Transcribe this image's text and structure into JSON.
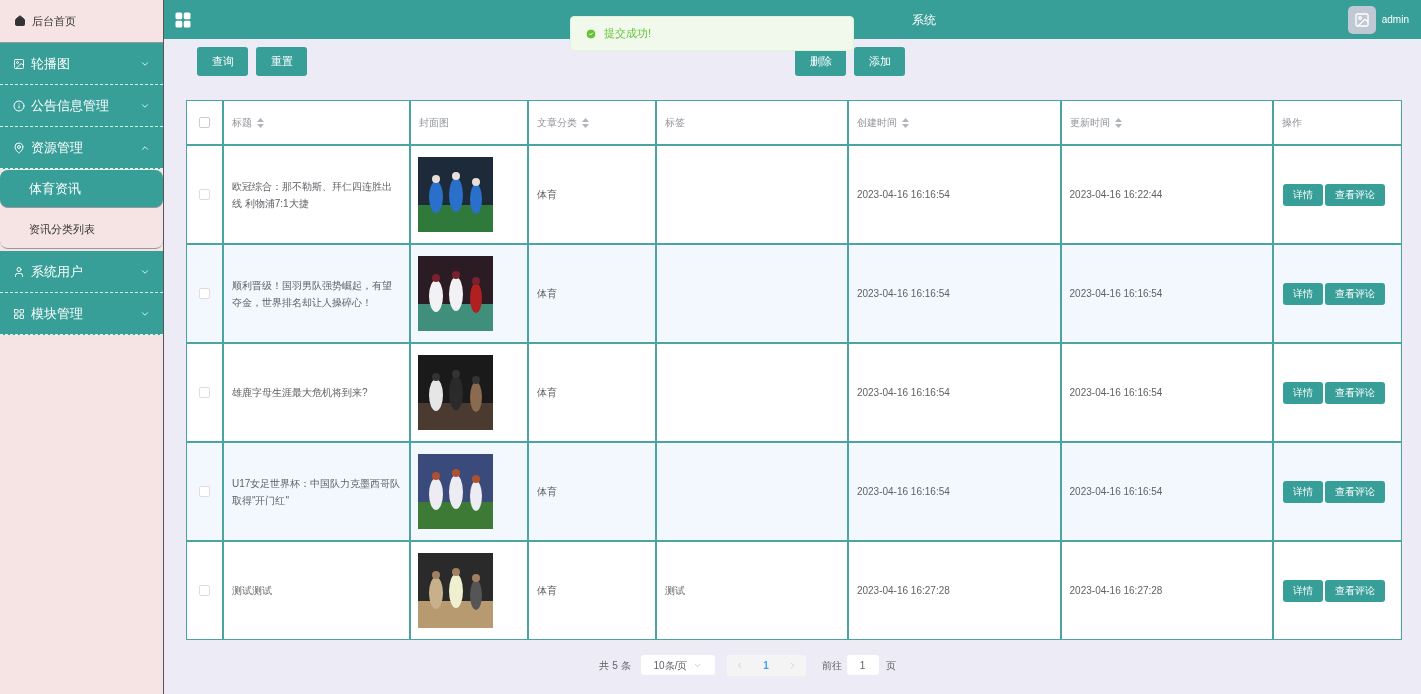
{
  "sidebar": {
    "items": [
      {
        "kind": "link",
        "label": "后台首页",
        "selected": false
      },
      {
        "kind": "menu",
        "label": "轮播图",
        "expanded": false
      },
      {
        "kind": "menu",
        "label": "公告信息管理",
        "expanded": false
      },
      {
        "kind": "menu",
        "label": "资源管理",
        "expanded": true,
        "children": [
          {
            "label": "体育资讯",
            "selected": true
          },
          {
            "label": "资讯分类列表",
            "selected": false
          }
        ]
      },
      {
        "kind": "menu",
        "label": "系统用户",
        "expanded": false
      },
      {
        "kind": "menu",
        "label": "模块管理",
        "expanded": false
      }
    ]
  },
  "header": {
    "title_visible": "系统",
    "user": "admin"
  },
  "toast": {
    "message": "提交成功!"
  },
  "toolbar": {
    "left_buttons": [
      "查询",
      "重置"
    ],
    "right_buttons": [
      "删除",
      "添加"
    ]
  },
  "table": {
    "columns": [
      {
        "label": "标题",
        "sortable": true
      },
      {
        "label": "封面图",
        "sortable": false
      },
      {
        "label": "文章分类",
        "sortable": true
      },
      {
        "label": "标签",
        "sortable": false
      },
      {
        "label": "创建时间",
        "sortable": true
      },
      {
        "label": "更新时间",
        "sortable": true
      },
      {
        "label": "操作",
        "sortable": false
      }
    ],
    "rows": [
      {
        "checked": false,
        "title": "欧冠综合：那不勒斯、拜仁四连胜出线 利物浦7:1大捷",
        "category": "体育",
        "tag": "",
        "created": "2023-04-16 16:16:54",
        "updated": "2023-04-16 16:22:44",
        "actions": [
          "详情",
          "查看评论"
        ]
      },
      {
        "checked": false,
        "title": "顺利晋级！国羽男队强势崛起，有望夺金，世界排名却让人操碎心！",
        "category": "体育",
        "tag": "",
        "created": "2023-04-16 16:16:54",
        "updated": "2023-04-16 16:16:54",
        "actions": [
          "详情",
          "查看评论"
        ]
      },
      {
        "checked": false,
        "title": "雄鹿字母生涯最大危机将到来?",
        "category": "体育",
        "tag": "",
        "created": "2023-04-16 16:16:54",
        "updated": "2023-04-16 16:16:54",
        "actions": [
          "详情",
          "查看评论"
        ]
      },
      {
        "checked": false,
        "title": "U17女足世界杯：中国队力克墨西哥队取得\"开门红\"",
        "category": "体育",
        "tag": "",
        "created": "2023-04-16 16:16:54",
        "updated": "2023-04-16 16:16:54",
        "actions": [
          "详情",
          "查看评论"
        ]
      },
      {
        "checked": false,
        "title": "测试测试",
        "category": "体育",
        "tag": "测试",
        "created": "2023-04-16 16:27:28",
        "updated": "2023-04-16 16:27:28",
        "actions": [
          "详情",
          "查看评论"
        ]
      }
    ],
    "select_all_checked": false
  },
  "pagination": {
    "total": "共 5 条",
    "page_size": "10条/页",
    "pages": [
      {
        "label": "1",
        "selected": true
      }
    ],
    "goto_label": "前往",
    "goto_value": "1",
    "page_suffix": "页"
  }
}
